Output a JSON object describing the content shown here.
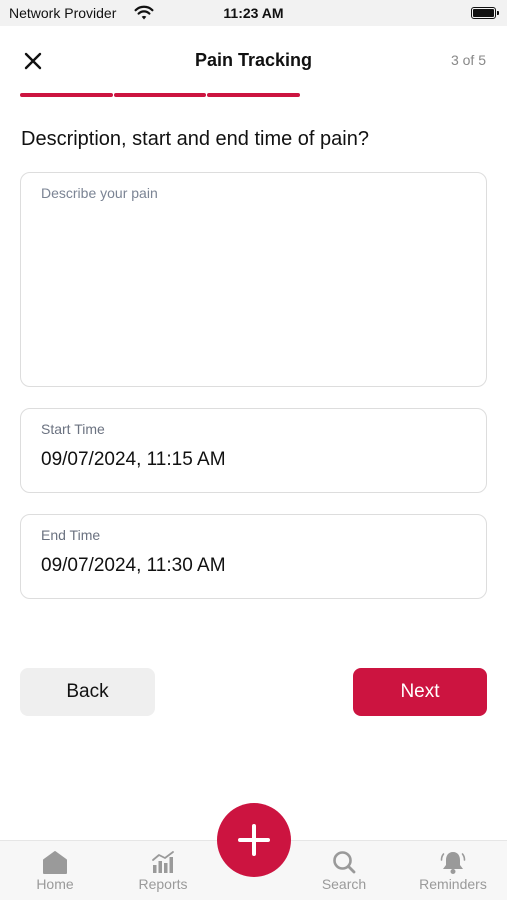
{
  "status_bar": {
    "carrier": "Network Provider",
    "time": "11:23 AM",
    "wifi_icon": "wifi-icon",
    "battery_icon": "battery-icon"
  },
  "header": {
    "title": "Pain Tracking",
    "step": "3 of 5",
    "close_icon": "close-icon"
  },
  "progress": {
    "total_steps": 5,
    "completed_steps": 3
  },
  "question": "Description, start and end time of pain?",
  "description": {
    "placeholder": "Describe your pain",
    "value": ""
  },
  "start_time": {
    "label": "Start Time",
    "value": "09/07/2024, 11:15 AM"
  },
  "end_time": {
    "label": "End Time",
    "value": "09/07/2024, 11:30 AM"
  },
  "buttons": {
    "back": "Back",
    "next": "Next"
  },
  "tab_bar": {
    "items": [
      {
        "label": "Home",
        "icon": "home-icon"
      },
      {
        "label": "Reports",
        "icon": "reports-icon"
      },
      {
        "label": "Search",
        "icon": "search-icon"
      },
      {
        "label": "Reminders",
        "icon": "bell-icon"
      }
    ],
    "fab_icon": "plus-icon"
  },
  "colors": {
    "accent": "#cc1440",
    "inactive_tab": "#9a9a9a",
    "progress_track": "#ffffff"
  }
}
